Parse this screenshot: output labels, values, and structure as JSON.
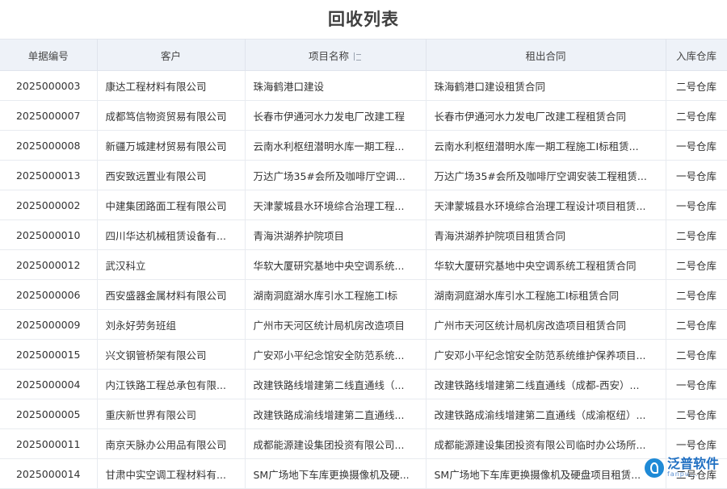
{
  "page": {
    "title": "回收列表"
  },
  "table": {
    "columns": [
      {
        "key": "no",
        "label": "单据编号"
      },
      {
        "key": "customer",
        "label": "客户"
      },
      {
        "key": "project",
        "label": "项目名称",
        "sort_icon": "sort-icon"
      },
      {
        "key": "contract",
        "label": "租出合同"
      },
      {
        "key": "warehouse",
        "label": "入库仓库"
      }
    ],
    "rows": [
      {
        "no": "2025000003",
        "customer": "康达工程材料有限公司",
        "project": "珠海鹤港口建设",
        "contract": "珠海鹤港口建设租赁合同",
        "warehouse": "二号仓库"
      },
      {
        "no": "2025000007",
        "customer": "成都笃信物资贸易有限公司",
        "project": "长春市伊通河水力发电厂改建工程",
        "contract": "长春市伊通河水力发电厂改建工程租赁合同",
        "warehouse": "二号仓库"
      },
      {
        "no": "2025000008",
        "customer": "新疆万城建材贸易有限公司",
        "project": "云南水利枢纽潜明水库一期工程...",
        "contract": "云南水利枢纽潜明水库一期工程施工I标租赁...",
        "warehouse": "一号仓库"
      },
      {
        "no": "2025000013",
        "customer": "西安致远置业有限公司",
        "project": "万达广场35#会所及咖啡厅空调...",
        "contract": "万达广场35#会所及咖啡厅空调安装工程租赁...",
        "warehouse": "一号仓库"
      },
      {
        "no": "2025000002",
        "customer": "中建集团路面工程有限公司",
        "project": "天津蒙城县水环境综合治理工程...",
        "contract": "天津蒙城县水环境综合治理工程设计项目租赁...",
        "warehouse": "一号仓库"
      },
      {
        "no": "2025000010",
        "customer": "四川华达机械租赁设备有...",
        "project": "青海洪湖养护院项目",
        "contract": "青海洪湖养护院项目租赁合同",
        "warehouse": "二号仓库"
      },
      {
        "no": "2025000012",
        "customer": "武汉科立",
        "project": "华软大厦研究基地中央空调系统...",
        "contract": "华软大厦研究基地中央空调系统工程租赁合同",
        "warehouse": "二号仓库"
      },
      {
        "no": "2025000006",
        "customer": "西安盛器金属材料有限公司",
        "project": "湖南洞庭湖水库引水工程施工I标",
        "contract": "湖南洞庭湖水库引水工程施工I标租赁合同",
        "warehouse": "二号仓库"
      },
      {
        "no": "2025000009",
        "customer": "刘永好劳务班组",
        "project": "广州市天河区统计局机房改造项目",
        "contract": "广州市天河区统计局机房改造项目租赁合同",
        "warehouse": "二号仓库"
      },
      {
        "no": "2025000015",
        "customer": "兴文钢管桥架有限公司",
        "project": "广安邓小平纪念馆安全防范系统...",
        "contract": "广安邓小平纪念馆安全防范系统维护保养项目...",
        "warehouse": "二号仓库"
      },
      {
        "no": "2025000004",
        "customer": "内江铁路工程总承包有限...",
        "project": "改建铁路线增建第二线直通线（...",
        "contract": "改建铁路线增建第二线直通线（成都-西安）...",
        "warehouse": "一号仓库"
      },
      {
        "no": "2025000005",
        "customer": "重庆新世界有限公司",
        "project": "改建铁路成渝线增建第二直通线...",
        "contract": "改建铁路成渝线增建第二直通线（成渝枢纽）...",
        "warehouse": "二号仓库"
      },
      {
        "no": "2025000011",
        "customer": "南京天脉办公用品有限公司",
        "project": "成都能源建设集团投资有限公司...",
        "contract": "成都能源建设集团投资有限公司临时办公场所...",
        "warehouse": "一号仓库"
      },
      {
        "no": "2025000014",
        "customer": "甘肃中实空调工程材料有...",
        "project": "SM广场地下车库更换摄像机及硬...",
        "contract": "SM广场地下车库更换摄像机及硬盘项目租赁...",
        "warehouse": "二号仓库"
      }
    ]
  },
  "watermark": {
    "brand": "泛普软件",
    "url": "fanpu...",
    "icon": "fanpu-logo-icon"
  },
  "colors": {
    "link": "#2a6fc9",
    "header_bg": "#eef2f8",
    "title": "#3f3f3f"
  }
}
